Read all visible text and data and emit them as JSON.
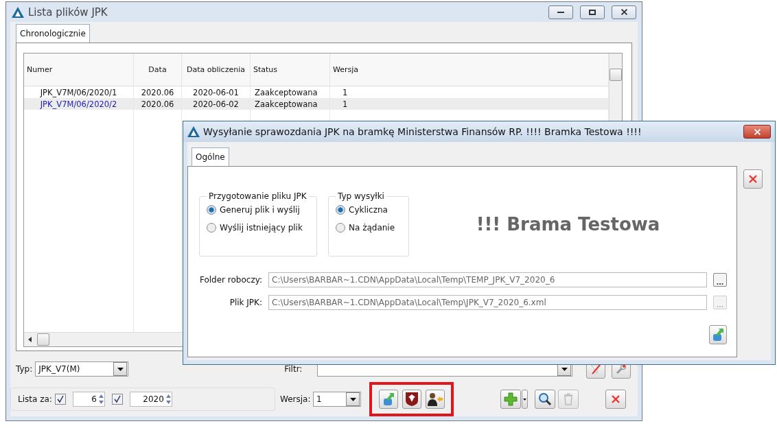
{
  "main_window": {
    "title": "Lista plików JPK",
    "tabs": [
      {
        "label": "Chronologicznie",
        "selected": true
      }
    ],
    "table": {
      "columns": [
        "Numer",
        "Data",
        "Data obliczenia",
        "Status",
        "Wersja"
      ],
      "rows": [
        {
          "cells": [
            "JPK_V7M/06/2020/1",
            "2020.06",
            "2020-06-01",
            "Zaakceptowana",
            "1"
          ],
          "selected": false
        },
        {
          "cells": [
            "JPK_V7M/06/2020/2",
            "2020.06",
            "2020-06-02",
            "Zaakceptowana",
            "1"
          ],
          "selected": true
        }
      ]
    },
    "typ": {
      "label": "Typ:",
      "value": "JPK_V7(M)"
    },
    "filtr": {
      "label": "Filtr:"
    },
    "lista_za": {
      "label": "Lista za:",
      "month_checked": true,
      "month": "6",
      "year_checked": true,
      "year": "2020"
    },
    "wersja": {
      "label": "Wersja:",
      "value": "1"
    }
  },
  "dialog": {
    "title": "Wysyłanie sprawozdania JPK na bramkę Ministerstwa Finansów RP. !!!! Bramka Testowa !!!!",
    "tabs": [
      {
        "label": "Ogólne",
        "selected": true
      }
    ],
    "groups": [
      {
        "title": "Przygotowanie pliku JPK",
        "options": [
          {
            "label": "Generuj plik i wyślij",
            "selected": true
          },
          {
            "label": "Wyślij istniejący plik",
            "selected": false
          }
        ]
      },
      {
        "title": "Typ wysyłki",
        "options": [
          {
            "label": "Cykliczna",
            "selected": true
          },
          {
            "label": "Na żądanie",
            "selected": false
          }
        ]
      }
    ],
    "banner": "!!! Brama Testowa",
    "fields": [
      {
        "label": "Folder roboczy:",
        "value": "C:\\Users\\BARBAR~1.CDN\\AppData\\Local\\Temp\\TEMP_JPK_V7_2020_6",
        "disabled": false
      },
      {
        "label": "Plik JPK:",
        "value": "C:\\Users\\BARBAR~1.CDN\\AppData\\Local\\Temp\\JPK_V7_2020_6.xml",
        "disabled": true
      }
    ]
  }
}
